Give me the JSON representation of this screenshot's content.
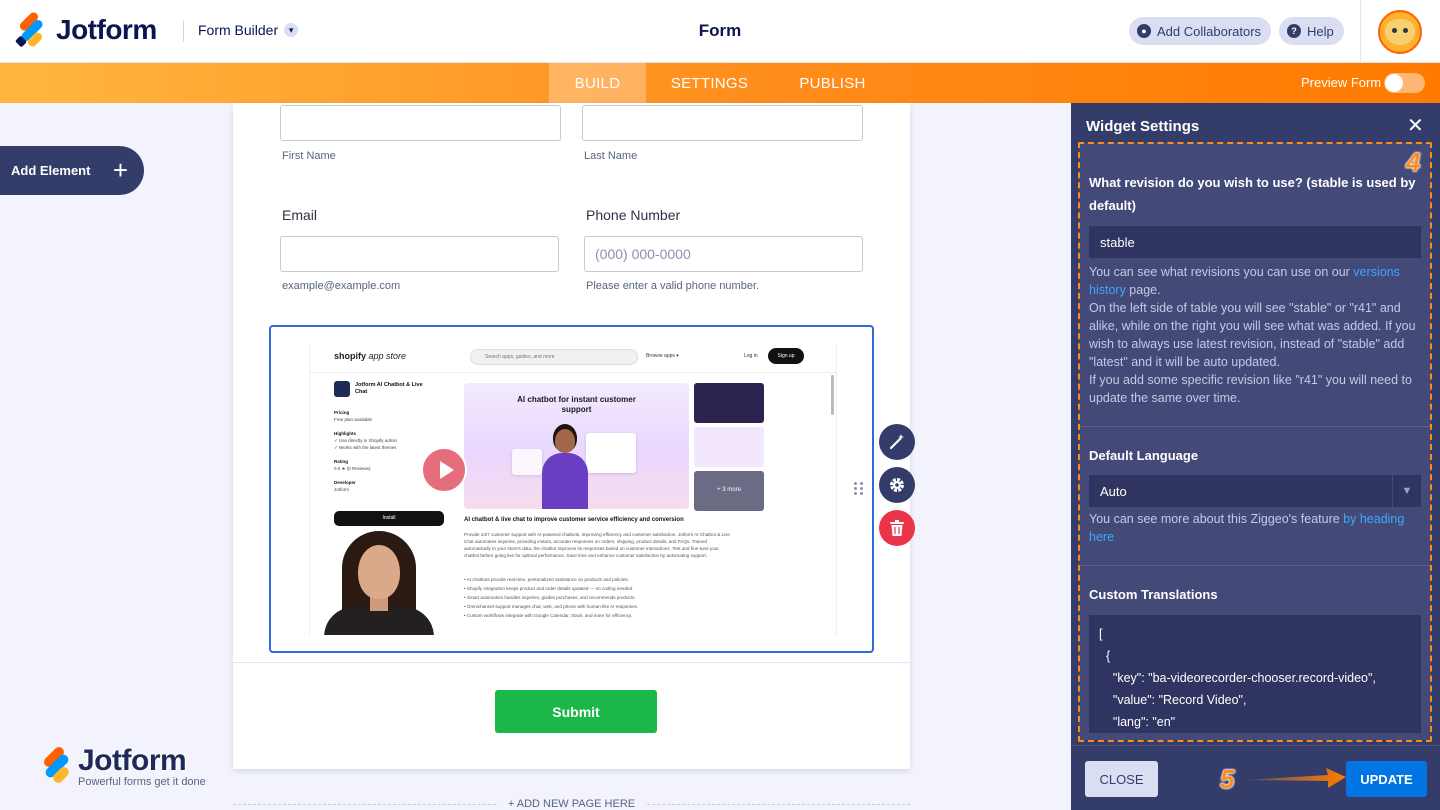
{
  "header": {
    "logo_text": "Jotform",
    "builder_label": "Form Builder",
    "form_title": "Form",
    "collaborators_label": "Add Collaborators",
    "help_label": "Help"
  },
  "nav": {
    "tabs": [
      {
        "label": "BUILD",
        "active": true
      },
      {
        "label": "SETTINGS",
        "active": false
      },
      {
        "label": "PUBLISH",
        "active": false
      }
    ],
    "preview_label": "Preview Form",
    "preview_on": false
  },
  "sidebar": {
    "add_element_label": "Add Element"
  },
  "form": {
    "first_name_sub": "First Name",
    "last_name_sub": "Last Name",
    "email_label": "Email",
    "email_sub": "example@example.com",
    "phone_label": "Phone Number",
    "phone_placeholder": "(000) 000-0000",
    "phone_sub": "Please enter a valid phone number.",
    "submit_label": "Submit",
    "add_page_label": "+ ADD NEW PAGE HERE"
  },
  "widget_preview": {
    "store_logo": "shopify",
    "store_logo_suffix": "app store",
    "search_placeholder": "Search apps, guides, and more",
    "browse_label": "Browse apps",
    "login_label": "Log in",
    "signup_label": "Sign up",
    "app_name": "Jotform AI Chatbot & Live Chat",
    "pricing_label": "Pricing",
    "pricing_value": "Free plan available",
    "highlights_label": "Highlights",
    "highlights": [
      "Use directly in Shopify admin",
      "Works with the latest themes"
    ],
    "rating_label": "Rating",
    "rating_value": "0.0 ★ (0 Reviews)",
    "developer_label": "Developer",
    "developer_value": "Jotform",
    "install_label": "Install",
    "hero_title": "AI chatbot for instant customer support",
    "thumb_more": "+ 3 more",
    "section_title": "AI chatbot & live chat to improve customer service efficiency and conversion",
    "paragraph": "Provide 24/7 customer support with AI-powered chatbots, improving efficiency and customer satisfaction. Jotform AI Chatbot & Live Chat automates inquiries, providing instant, accurate responses on orders, shipping, product details, and FAQs. Trained automatically to your store's data, the chatbot improves its responses based on customer interactions. Test and fine-tune your chatbot before going live for optimal performance. Save time and enhance customer satisfaction by automating support.",
    "bullets": [
      "AI chatbots provide real-time, personalized assistance on products and policies.",
      "Shopify integration keeps product and order details updated — no coding needed.",
      "Smart automation handles inquiries, guides purchases, and recommends products.",
      "Omnichannel support manages chat, web, and phone with human-like AI responses.",
      "Custom workflows integrate with Google Calendar, Slack, and more for efficiency."
    ]
  },
  "watermark": {
    "text": "Jotform",
    "tagline": "Powerful forms get it done"
  },
  "panel": {
    "title": "Widget Settings",
    "annotation_4": "4",
    "annotation_5": "5",
    "revision": {
      "label": "What revision do you wish to use? (stable is used by default)",
      "value": "stable",
      "help_before": "You can see what revisions you can use on our ",
      "help_link": "versions history",
      "help_after": " page.",
      "help_line2": "On the left side of table you will see \"stable\" or \"r41\" and alike, while on the right you will see what was added. If you wish to always use latest revision, instead of \"stable\" add \"latest\" and it will be auto updated.",
      "help_line3": "If you add some specific revision like \"r41\" you will need to update the same over time."
    },
    "language": {
      "label": "Default Language",
      "value": "Auto",
      "help_before": "You can see more about this Ziggeo's feature ",
      "help_link": "by heading here"
    },
    "translations": {
      "label": "Custom Translations",
      "value": "[\n  {\n    \"key\": \"ba-videorecorder-chooser.record-video\",\n    \"value\": \"Record Video\",\n    \"lang\": \"en\""
    },
    "close_label": "CLOSE",
    "update_label": "UPDATE"
  },
  "colors": {
    "brand_navy": "#0a1551",
    "panel_bg": "#343c6a",
    "nav_orange": "#ff8c1a",
    "submit_green": "#1bb749",
    "update_blue": "#0075e3",
    "delete_red": "#e9344a",
    "link_blue": "#3ea7ff"
  },
  "icons": {
    "wand": "magic-wand-icon",
    "gear": "gear-icon",
    "trash": "trash-icon",
    "close": "close-icon",
    "plus": "plus-icon",
    "help": "question-icon",
    "collaborators": "user-icon"
  }
}
